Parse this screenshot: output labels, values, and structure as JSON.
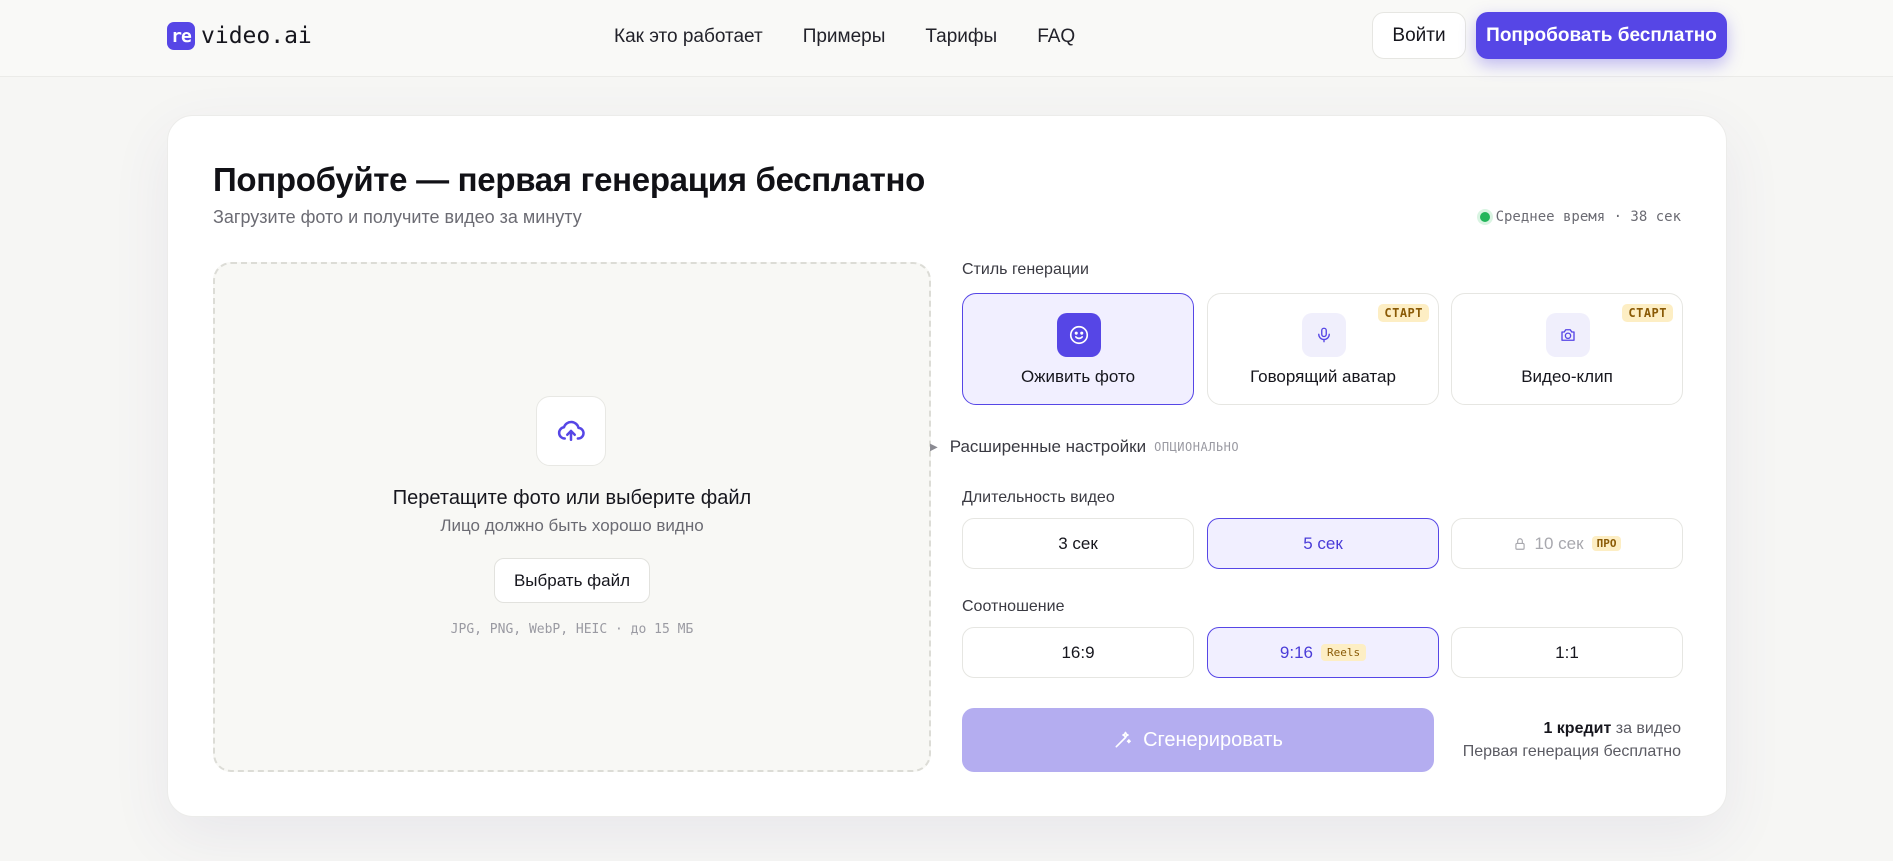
{
  "header": {
    "logo_mark": "re",
    "logo_text": "video.ai",
    "nav": [
      "Как это работает",
      "Примеры",
      "Тарифы",
      "FAQ"
    ],
    "login_label": "Войти",
    "try_label": "Попробовать бесплатно"
  },
  "card": {
    "title": "Попробуйте — первая генерация бесплатно",
    "subtitle": "Загрузите фото и получите видео за минуту",
    "avg_time": "Среднее время · 38 сек"
  },
  "upload": {
    "title": "Перетащите фото или выберите файл",
    "hint": "Лицо должно быть хорошо видно",
    "button_label": "Выбрать файл",
    "formats": "JPG, PNG, WebP, HEIC · до 15 МБ"
  },
  "style": {
    "label": "Стиль генерации",
    "options": [
      {
        "label": "Оживить фото",
        "icon": "smile-icon",
        "badge": ""
      },
      {
        "label": "Говорящий аватар",
        "icon": "microphone-icon",
        "badge": "СТАРТ"
      },
      {
        "label": "Видео-клип",
        "icon": "camera-icon",
        "badge": "СТАРТ"
      }
    ],
    "selected": 0
  },
  "advanced": {
    "label": "Расширенные настройки",
    "tag": "ОПЦИОНАЛЬНО"
  },
  "duration": {
    "label": "Длительность видео",
    "options": [
      {
        "label": "3 сек"
      },
      {
        "label": "5 сек"
      },
      {
        "label": "10 сек",
        "badge": "ПРО",
        "locked": true
      }
    ],
    "selected": 1
  },
  "ratio": {
    "label": "Соотношение",
    "options": [
      {
        "label": "16:9"
      },
      {
        "label": "9:16",
        "badge": "Reels"
      },
      {
        "label": "1:1"
      }
    ],
    "selected": 1
  },
  "generate": {
    "label": "Сгенерировать",
    "credit_strong": "1 кредит",
    "credit_suffix": " за видео",
    "credit_note": "Первая генерация бесплатно"
  },
  "colors": {
    "accent": "#5646e6",
    "accent_soft": "#f1efff",
    "badge_bg": "#fdeec4",
    "status_green": "#22b55a"
  }
}
